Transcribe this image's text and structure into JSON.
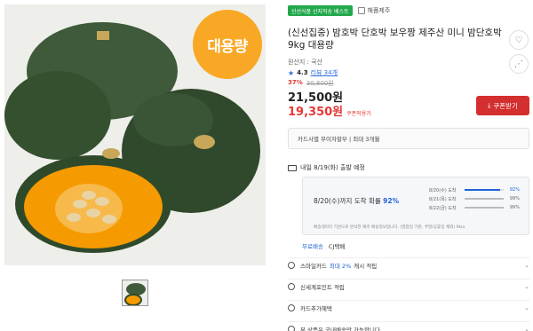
{
  "image": {
    "badge_text": "대용량"
  },
  "tags": {
    "green_tag": "신선식품 산지직송 베스트",
    "store_name": "해품제주"
  },
  "product": {
    "title": "(신선집중) 밤호박 단호박 보우짱 제주산 미니 밤단호박 9kg 대용량",
    "origin": "원산지 : 국산",
    "rating_score": "4.3",
    "rating_reviews": "리뷰 34개",
    "discount_pct": "37%",
    "original_price": "30,800원",
    "price": "21,500원",
    "coupon_price": "19,350원",
    "coupon_price_label": "쿠폰적용가",
    "coupon_button": "쿠폰받기"
  },
  "card_info": "카드사별 무이자할부 | 최대 3개월",
  "shipping": {
    "eta": "내일 8/19(화) 출발 예정",
    "prob_main_prefix": "8/20(수)까지 도착 확률",
    "prob_main_pct": "92%",
    "prob_items": [
      {
        "date": "8/20(수) 도착",
        "pct": "92%",
        "fill": 0.92
      },
      {
        "date": "8/21(목) 도착",
        "pct": "99%",
        "fill": 0.99
      },
      {
        "date": "8/22(금) 도착",
        "pct": "99%",
        "fill": 0.99
      }
    ],
    "prob_note": "배송데이터 기반으로 분석한 예측 배송정보입니다. (영업일 기준, 주말/공휴일 제외) 9kia",
    "free_label": "무료배송",
    "courier": "CJ택배"
  },
  "benefits": [
    {
      "prefix": "스마일카드",
      "highlight": "최대 2%",
      "suffix": "캐시 적립"
    },
    {
      "prefix": "신세계포인트 적립",
      "highlight": "",
      "suffix": ""
    },
    {
      "prefix": "카드추가혜택",
      "highlight": "",
      "suffix": ""
    },
    {
      "prefix": "본 상품은 국내배송만 가능합니다",
      "highlight": "",
      "suffix": ""
    }
  ],
  "colors": {
    "accent_blue": "#1e63d6",
    "sale_red": "#e53935",
    "badge_orange": "#f9a825",
    "tag_green": "#21a84b"
  }
}
